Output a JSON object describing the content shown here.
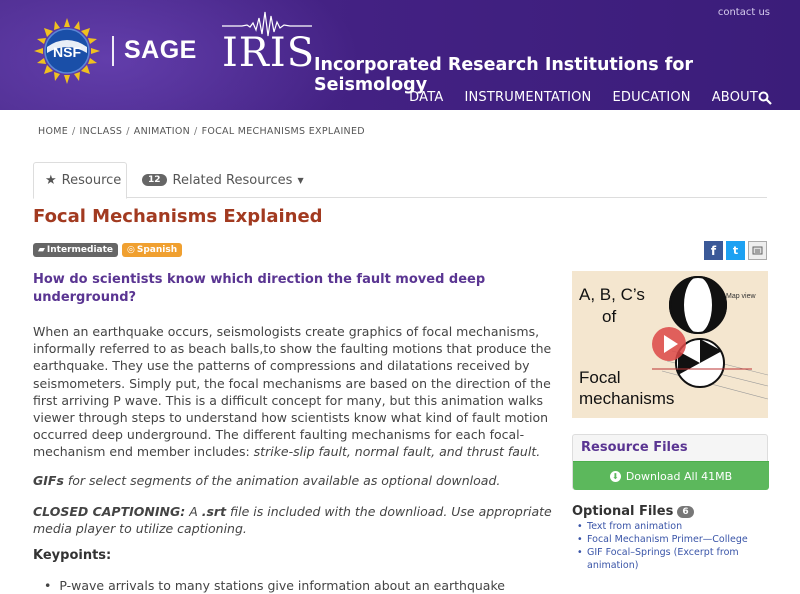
{
  "header": {
    "contact": "contact us",
    "sage": "SAGE",
    "nsf": "NSF",
    "iris": "IRIS",
    "iris_full": "Incorporated Research Institutions for Seismology",
    "nav": [
      "DATA",
      "INSTRUMENTATION",
      "EDUCATION",
      "ABOUT"
    ],
    "search_icon": "search-icon"
  },
  "breadcrumb": [
    "HOME",
    "INCLASS",
    "ANIMATION",
    "FOCAL MECHANISMS EXPLAINED"
  ],
  "tabs": {
    "resource": "Resource",
    "related_count": "12",
    "related": "Related Resources"
  },
  "title": "Focal Mechanisms Explained",
  "tags": [
    "Intermediate",
    "Spanish"
  ],
  "social": [
    "f",
    "t"
  ],
  "question": "How do scientists know which direction the fault moved deep underground?",
  "body": {
    "intro": "When an earthquake occurs, seismologists create graphics of focal mechanisms, informally referred to as beach balls,to show the faulting motions that produce the earthquake. They use the patterns of compressions and dilatations received by seismometers. Simply put, the focal mechanisms are based on the direction of the first arriving P wave. This is a difficult concept for many, but this animation walks viewer through steps to understand how scientists know what kind of fault motion occurred deep underground. The different faulting mechanisms for each focal-mechanism end member includes: ",
    "intro_italic": "strike-slip fault, normal fault, and thrust fault.",
    "gifs_bold": "GIFs",
    "gifs": " for select segments of the animation available as optional download.",
    "cc_bold": "CLOSED CAPTIONING:",
    "cc_a": " A ",
    "cc_srt": ".srt",
    "cc_rest": " file is included with the downlioad. Use appropriate media player to utilize captioning.",
    "keypoints": "Keypoints:",
    "bullet1": "P-wave arrivals to many stations give information about an earthquake"
  },
  "thumbnail": {
    "line1": "A, B, C’s",
    "line2": "of",
    "line3": "Focal",
    "line4": "mechanisms",
    "map_view": "Map view"
  },
  "sidebar": {
    "resource_files": "Resource Files",
    "download": "Download All 41MB",
    "optional_files": "Optional Files",
    "optional_count": "6",
    "optional_items": [
      "Text from animation",
      "Focal Mechanism Primer—College",
      "GIF Focal–Springs (Excerpt from animation)"
    ]
  },
  "colors": {
    "header_purple": "#432183",
    "title_red": "#a23a20",
    "question_purple": "#5a3592",
    "download_green": "#5cb85c",
    "link_blue": "#3a55a8"
  }
}
